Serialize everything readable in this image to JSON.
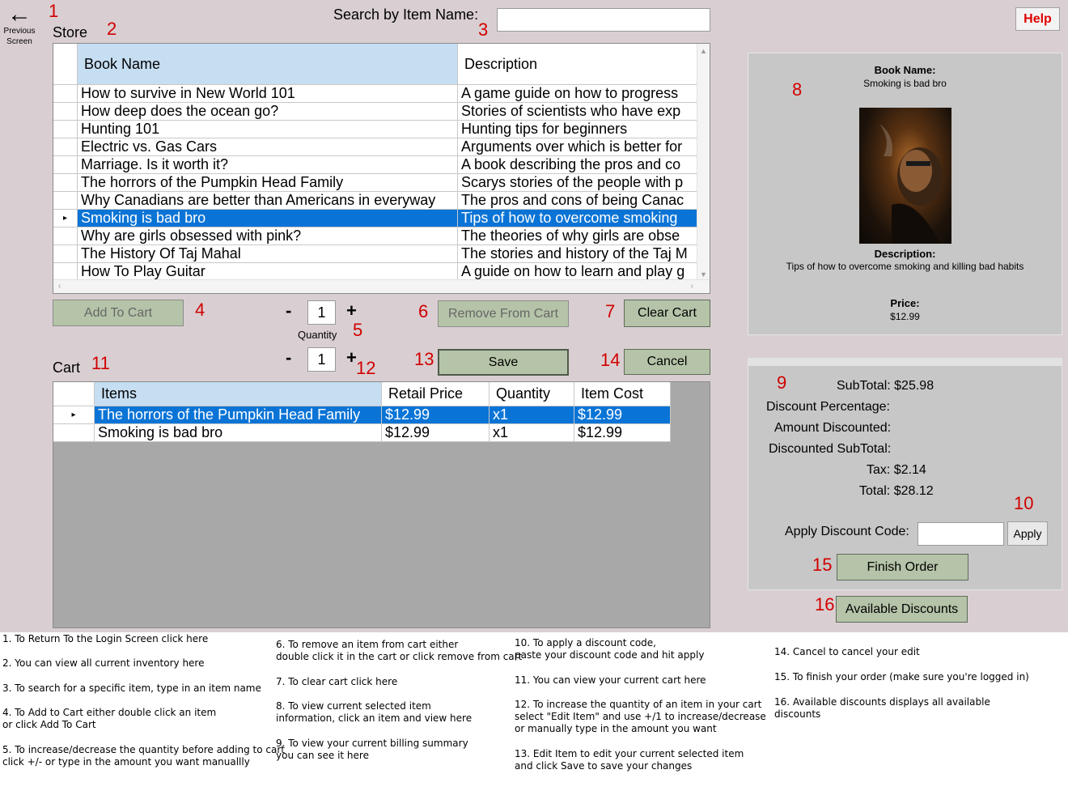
{
  "nav": {
    "back_arrow": "←",
    "back_label": "Previous\nScreen",
    "help": "Help"
  },
  "store": {
    "title": "Store",
    "search_label": "Search by Item Name:",
    "search_value": ""
  },
  "inventory": {
    "columns": [
      "Book Name",
      "Description"
    ],
    "rows": [
      [
        "How to survive in New World 101",
        "A game guide on how to progress"
      ],
      [
        "How deep does the ocean go?",
        "Stories of scientists who have exp"
      ],
      [
        "Hunting 101",
        "Hunting tips for beginners"
      ],
      [
        "Electric vs. Gas Cars",
        "Arguments over which is better for"
      ],
      [
        "Marriage. Is it worth it?",
        "A book describing the pros and co"
      ],
      [
        "The horrors of the Pumpkin Head Family",
        "Scarys stories of the people with p"
      ],
      [
        "Why Canadians are better than Americans in everyway",
        "The pros and cons of being Canac"
      ],
      [
        "Smoking is bad bro",
        "Tips of how to overcome smoking"
      ],
      [
        "Why are girls obsessed with pink?",
        "The theories of why girls are obse"
      ],
      [
        "The History Of Taj Mahal",
        "The stories and history of the Taj M"
      ],
      [
        "How To Play Guitar",
        "A guide on how to learn and play g"
      ]
    ],
    "selected_index": 7
  },
  "controls": {
    "add_to_cart": "Add To Cart",
    "minus": "-",
    "plus": "+",
    "quantity_value": "1",
    "quantity_label": "Quantity",
    "remove_from_cart": "Remove From Cart",
    "clear_cart": "Clear Cart",
    "edit_quantity_value": "1",
    "save": "Save",
    "cancel": "Cancel"
  },
  "cart": {
    "title": "Cart",
    "columns": [
      "Items",
      "Retail Price",
      "Quantity",
      "Item Cost"
    ],
    "rows": [
      [
        "The horrors of the Pumpkin Head Family",
        "$12.99",
        "x1",
        "$12.99"
      ],
      [
        "Smoking is bad bro",
        "$12.99",
        "x1",
        "$12.99"
      ]
    ],
    "selected_index": 0
  },
  "details": {
    "name_label": "Book Name:",
    "name_value": "Smoking is bad bro",
    "description_label": "Description:",
    "description_value": "Tips of how to overcome smoking and killing bad habits",
    "price_label": "Price:",
    "price_value": "$12.99"
  },
  "billing": {
    "subtotal": "SubTotal: $25.98",
    "discount_percentage": "Discount Percentage:",
    "amount_discounted": "Amount Discounted:",
    "discounted_subtotal": "Discounted SubTotal:",
    "tax": "Tax: $2.14",
    "total": "Total: $28.12",
    "discount_code_label": "Apply Discount Code:",
    "discount_code_value": "",
    "apply": "Apply",
    "finish_order": "Finish Order",
    "available_discounts": "Available Discounts"
  },
  "markers": [
    "1",
    "2",
    "3",
    "4",
    "5",
    "6",
    "7",
    "8",
    "9",
    "10",
    "11",
    "12",
    "13",
    "14",
    "15",
    "16"
  ],
  "help_text": [
    "1. To Return To the Login Screen click here",
    "2. You can view all current inventory here",
    "3. To search for a specific item, type in an item name",
    "4. To Add to Cart either double click an item\nor click Add To Cart",
    "5. To increase/decrease the quantity before adding to cart\nclick +/- or type in the amount you want manuallly",
    "6. To remove an item from cart either\n double click it in the cart or click remove from cart",
    "7. To clear cart click here",
    "8. To view current selected item\ninformation, click an item and view here",
    "9. To view your current billing summary\nyou can see it here",
    "10. To apply a discount code,\npaste your discount code and hit apply",
    "11. You can view your current cart here",
    "12. To increase the quantity of an item in your cart\nselect \"Edit Item\" and use +/1 to increase/decrease\nor manually type in the amount you want",
    "13. Edit Item to edit your current selected item\nand click Save to save your changes",
    "14. Cancel to cancel your edit",
    "15. To finish your order (make sure you're logged in)",
    "16. Available discounts displays all available\ndiscounts"
  ],
  "colors": {
    "background": "#d9cfd2",
    "selection": "#0a74d6",
    "button": "#b5c4a8",
    "marker": "#d10000"
  }
}
